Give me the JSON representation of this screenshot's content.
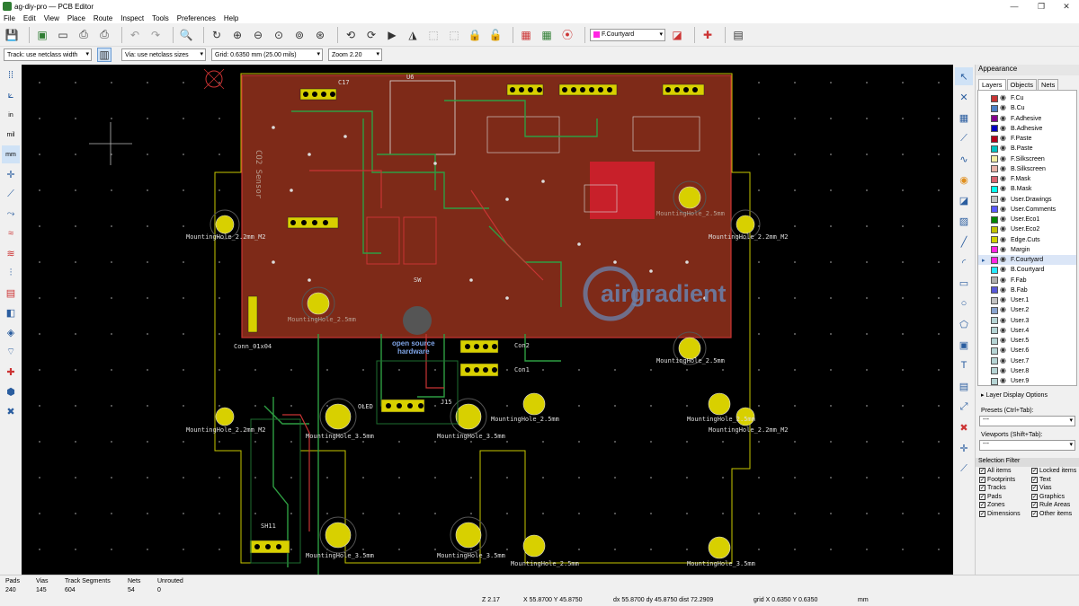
{
  "window": {
    "title": "ag-diy-pro — PCB Editor"
  },
  "menu": [
    "File",
    "Edit",
    "View",
    "Place",
    "Route",
    "Inspect",
    "Tools",
    "Preferences",
    "Help"
  ],
  "toolbar": {
    "layer_select": "F.Courtyard"
  },
  "toolbar2": {
    "track": "Track: use netclass width",
    "via": "Via: use netclass sizes",
    "grid": "Grid: 0.6350 mm (25.00 mils)",
    "zoom": "Zoom 2.20"
  },
  "left_units": {
    "in": "in",
    "mil": "mil",
    "mm": "mm"
  },
  "pcb": {
    "labels": {
      "u6": "U6",
      "c17": "C17",
      "u1": "U1",
      "co2": "CO2 Sensor",
      "mh1": "MountingHole_2.2mm_M2",
      "mh2": "MountingHole_2.2mm_M2",
      "mh3": "MountingHole_2.5mm",
      "mh4": "MountingHole_2.5mm",
      "mh5": "MountingHole_2.5mm",
      "mh6": "MountingHole_2.2mm_M2",
      "mh7": "MountingHole_3.5mm",
      "mh8": "MountingHole_3.5mm",
      "mh9": "MountingHole_2.5mm",
      "mh10": "MountingHole_2.2mm_M2",
      "mh11": "MountingHole_3.5mm",
      "mh12": "MountingHole_3.5mm",
      "mh13": "MountingHole_2.5mm",
      "mh14": "MountingHole_2.5mm",
      "mh15": "MountingHole_3.5mm",
      "conn": "Conn_01x04",
      "oled": "OLED",
      "osh1": "open source",
      "osh2": "hardware",
      "brand": "airgradient",
      "con1": "Con1",
      "con2": "Con2",
      "sw": "SW",
      "led": "LED",
      "d1": "D1",
      "d2": "D2",
      "j15": "J15",
      "sh11": "SH11"
    }
  },
  "appearance": {
    "title": "Appearance",
    "tabs": [
      "Layers",
      "Objects",
      "Nets"
    ],
    "layers": [
      {
        "name": "F.Cu",
        "color": "#c83434"
      },
      {
        "name": "B.Cu",
        "color": "#4d7fc4"
      },
      {
        "name": "F.Adhesive",
        "color": "#84008e"
      },
      {
        "name": "B.Adhesive",
        "color": "#0000c2"
      },
      {
        "name": "F.Paste",
        "color": "#b4001c"
      },
      {
        "name": "B.Paste",
        "color": "#00c2c2"
      },
      {
        "name": "F.Silkscreen",
        "color": "#f2eda1"
      },
      {
        "name": "B.Silkscreen",
        "color": "#e8b2a7"
      },
      {
        "name": "F.Mask",
        "color": "#d86470"
      },
      {
        "name": "B.Mask",
        "color": "#02ffee"
      },
      {
        "name": "User.Drawings",
        "color": "#c2c2c2"
      },
      {
        "name": "User.Comments",
        "color": "#5959ff"
      },
      {
        "name": "User.Eco1",
        "color": "#008500"
      },
      {
        "name": "User.Eco2",
        "color": "#c2c200"
      },
      {
        "name": "Edge.Cuts",
        "color": "#d0d200"
      },
      {
        "name": "Margin",
        "color": "#ff26e2"
      },
      {
        "name": "F.Courtyard",
        "color": "#ff26e2"
      },
      {
        "name": "B.Courtyard",
        "color": "#26e9ff"
      },
      {
        "name": "F.Fab",
        "color": "#afafaf"
      },
      {
        "name": "B.Fab",
        "color": "#5858d8"
      },
      {
        "name": "User.1",
        "color": "#c2c2c2"
      },
      {
        "name": "User.2",
        "color": "#89a4cf"
      },
      {
        "name": "User.3",
        "color": "#b5d4d4"
      },
      {
        "name": "User.4",
        "color": "#b5d4d4"
      },
      {
        "name": "User.5",
        "color": "#b5d4d4"
      },
      {
        "name": "User.6",
        "color": "#b5d4d4"
      },
      {
        "name": "User.7",
        "color": "#b5d4d4"
      },
      {
        "name": "User.8",
        "color": "#b5d4d4"
      },
      {
        "name": "User.9",
        "color": "#b5d4d4"
      }
    ],
    "layer_options": "Layer Display Options",
    "presets_label": "Presets (Ctrl+Tab):",
    "presets_value": "---",
    "viewports_label": "Viewports (Shift+Tab):",
    "viewports_value": "---",
    "filter_title": "Selection Filter",
    "filters": [
      "All items",
      "Locked items",
      "Footprints",
      "Text",
      "Tracks",
      "Vias",
      "Pads",
      "Graphics",
      "Zones",
      "Rule Areas",
      "Dimensions",
      "Other items"
    ]
  },
  "status": {
    "pads_label": "Pads",
    "pads": "240",
    "vias_label": "Vias",
    "vias": "145",
    "tracks_label": "Track Segments",
    "tracks": "604",
    "nets_label": "Nets",
    "nets": "54",
    "unrouted_label": "Unrouted",
    "unrouted": "0",
    "zoom": "Z 2.17",
    "xy": "X 55.8700  Y 45.8750",
    "delta": "dx 55.8700  dy 45.8750  dist 72.2909",
    "grid": "grid X 0.6350  Y 0.6350",
    "units": "mm"
  }
}
